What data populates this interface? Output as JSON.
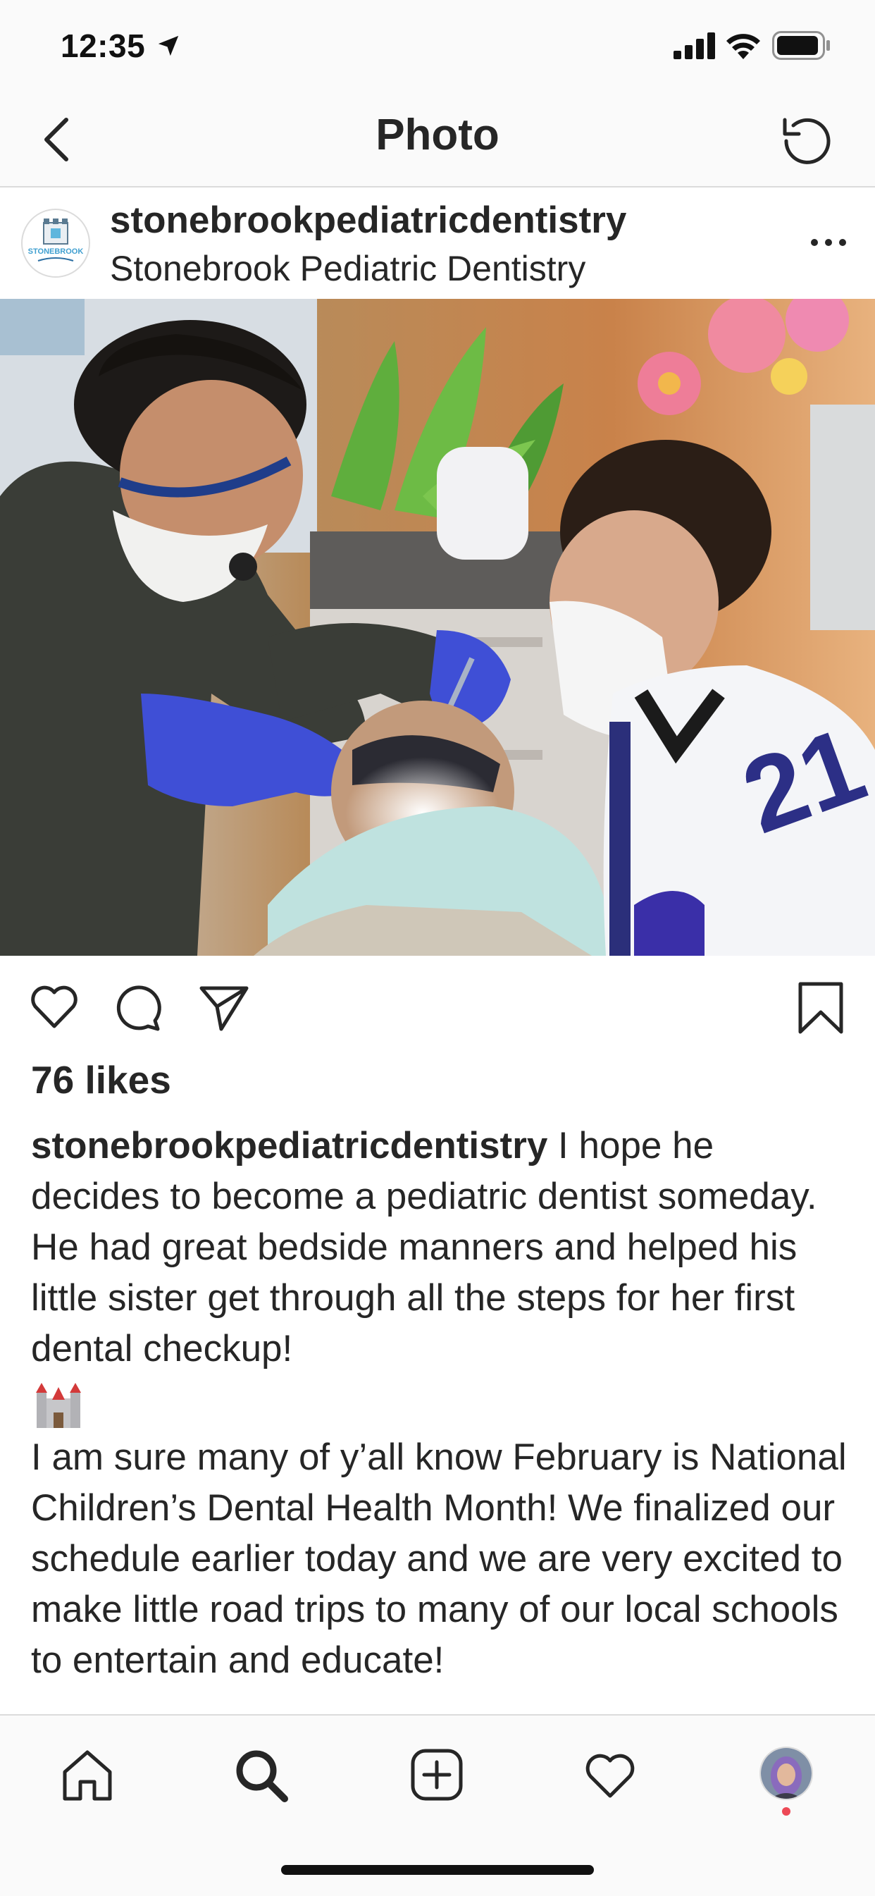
{
  "status_bar": {
    "time": "12:35"
  },
  "nav": {
    "title": "Photo"
  },
  "post": {
    "username": "stonebrookpediatricdentistry",
    "location": "Stonebrook Pediatric Dentistry",
    "avatar_text": "STONEBROOK",
    "jersey_number": "21"
  },
  "engagement": {
    "likes": "76 likes"
  },
  "caption": {
    "username": "stonebrookpediatricdentistry",
    "para1": " I hope he decides to become a pediatric dentist someday. He had great bedside manners and helped his little sister get through all the steps for her first dental checkup!",
    "para2": "I am sure many of y’all know February is National Children’s Dental Health Month! We finalized our schedule earlier today and we are very excited to make little road trips to many of our local schools to entertain and educate!"
  },
  "icons": [
    "location-arrow-icon",
    "signal-icon",
    "wifi-icon",
    "battery-icon",
    "back-icon",
    "refresh-icon",
    "more-icon",
    "like-icon",
    "comment-icon",
    "share-icon",
    "bookmark-icon",
    "home-icon",
    "search-icon",
    "new-post-icon",
    "activity-icon",
    "profile-avatar",
    "castle-emoji"
  ],
  "colors": {
    "bar_bg": "#fafafa",
    "text": "#262626",
    "divider": "#dbdbdb",
    "notification": "#ed4956",
    "glove": "#3f4fd6",
    "shirt": "#3a3d37"
  }
}
